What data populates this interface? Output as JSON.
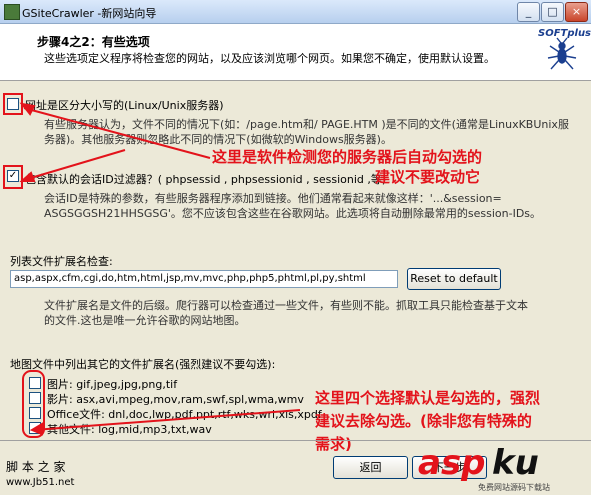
{
  "window": {
    "title": "GSiteCrawler -新网站向导"
  },
  "header": {
    "step_title": "步骤4之2：有些选项",
    "step_desc": "这些选项定义程序将检查您的网站，以及应该浏览哪个网页。如果您不确定，使用默认设置。",
    "logo_text": "SOFTplus"
  },
  "options": {
    "case_sensitive": {
      "label": "网址是区分大小写的(Linux/Unix服务器)",
      "checked": false,
      "desc_line1": "有些服务器认为，文件不同的情况下(如：/page.htm和/ PAGE.HTM )是不同的文件(通常是LinuxKBUnix服",
      "desc_line2": "务器)。其他服务器则忽略此不同的情况下(如微软的Windows服务器)。"
    },
    "session_filter": {
      "label": "包含默认的会话ID过滤器？( phpsessid , phpsessionid , sessionid ,等)",
      "checked": true,
      "desc_line1": "会话ID是特殊的参数，有些服务器程序添加到链接。他们通常看起来就像这样：'...&session=",
      "desc_line2": "ASGSGGSH21HHSGSG'。您不应该包含这些在谷歌网站。此选项将自动删除最常用的session-IDs。"
    }
  },
  "extensions": {
    "label": "列表文件扩展名检查:",
    "value": "asp,aspx,cfm,cgi,do,htm,html,jsp,mv,mvc,php,php5,phtml,pl,py,shtml",
    "reset_label": "Reset to default",
    "desc_line1": "文件扩展名是文件的后缀。爬行器可以检查通过一些文件，有些则不能。抓取工具只能检查基于文本",
    "desc_line2": "的文件.这也是唯一允许谷歌的网站地图。"
  },
  "other_ext": {
    "label": "地图文件中列出其它的文件扩展名(强烈建议不要勾选):",
    "items": [
      {
        "label": "图片: gif,jpeg,jpg,png,tif",
        "checked": false
      },
      {
        "label": "影片: asx,avi,mpeg,mov,ram,swf,spl,wma,wmv",
        "checked": false
      },
      {
        "label": "Office文件: dnl,doc,lwp,pdf,ppt,rtf,wks,wri,xls,xpdf",
        "checked": false
      },
      {
        "label": "其他文件: log,mid,mp3,txt,wav",
        "checked": false
      }
    ]
  },
  "annotations": {
    "auto_check": "这里是软件检测您的服务器后自动勾选的",
    "dont_change": "建议不要改动它",
    "four_options_1": "这里四个选择默认是勾选的，强烈",
    "four_options_2": "建议去除勾选。(除非您有特殊的",
    "four_options_3": "需求)"
  },
  "footer": {
    "site_name": "脚 本 之 家",
    "site_url": "www.Jb51.net",
    "back_label": "返回",
    "next_label": "下一步",
    "watermark_asp": "asp",
    "watermark_ku": "ku",
    "watermark_sub": "免费网站源码下载站"
  },
  "titlebar_buttons": {
    "min": "_",
    "max": "□",
    "close": "×"
  },
  "colors": {
    "annotation_red": "#e3131b",
    "window_bg": "#ece9d8"
  }
}
